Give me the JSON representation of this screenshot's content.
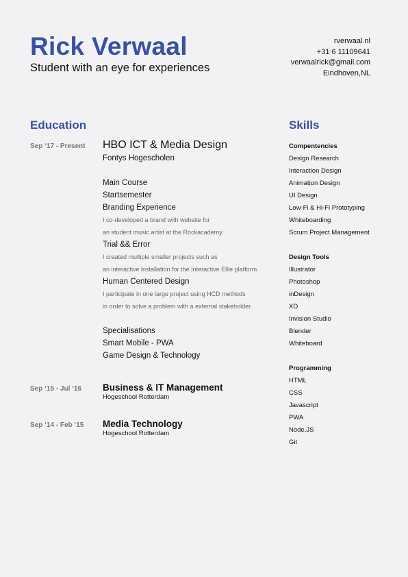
{
  "header": {
    "name": "Rick Verwaal",
    "tagline": "Student with an eye for experiences",
    "contact": [
      "rverwaal.nl",
      "+31 6 11109641",
      "verwaalrick@gmail.com",
      "Eindhoven,NL"
    ]
  },
  "education": {
    "title": "Education",
    "entries": [
      {
        "date": "Sep  ‘17 - Present",
        "program": "HBO ICT & Media Design",
        "school": "Fontys Hogescholen",
        "main_course": {
          "label": "Main Course",
          "items": [
            {
              "title": "Startsemester",
              "desc": []
            },
            {
              "title": "Branding Experience",
              "desc": [
                "I co-developed a brand with website for",
                "an student music artist at the Rockacademy."
              ]
            },
            {
              "title": "Trial && Error",
              "desc": [
                "I created multiple smaller projects such as",
                "an interactive installation for the Interactive Ellie platform."
              ]
            },
            {
              "title": "Human Centered Design",
              "desc": [
                "I participate in one large project using HCD methods",
                "in order to solve a problem with a external stakeholder."
              ]
            }
          ]
        },
        "specialisations": {
          "label": "Specialisations",
          "items": [
            "Smart Mobile - PWA",
            "Game Design & Technology"
          ]
        }
      },
      {
        "date": "Sep  ‘15 - Jul ‘16",
        "program": "Business & IT Management",
        "school": "Hogeschool Rotterdam"
      },
      {
        "date": "Sep ‘14 - Feb ‘15",
        "program": "Media Technology",
        "school": "Hogeschool Rotterdam"
      }
    ]
  },
  "skills": {
    "title": "Skills",
    "groups": [
      {
        "name": "Compentencies",
        "items": [
          "Design Research",
          "Interaction Design",
          "Animation Design",
          "UI Design",
          "Low-Fi & Hi-Fi Prototyping",
          "Whiteboarding",
          "Scrum Project Management"
        ]
      },
      {
        "name": "Design Tools",
        "items": [
          "Illustrator",
          "Photoshop",
          "inDesign",
          "XD",
          "Invision Studio",
          "Blender",
          "Whiteboard"
        ]
      },
      {
        "name": "Programming",
        "items": [
          "HTML",
          "CSS",
          "Javascript",
          "PWA",
          "Node.JS",
          "Git"
        ]
      }
    ]
  }
}
